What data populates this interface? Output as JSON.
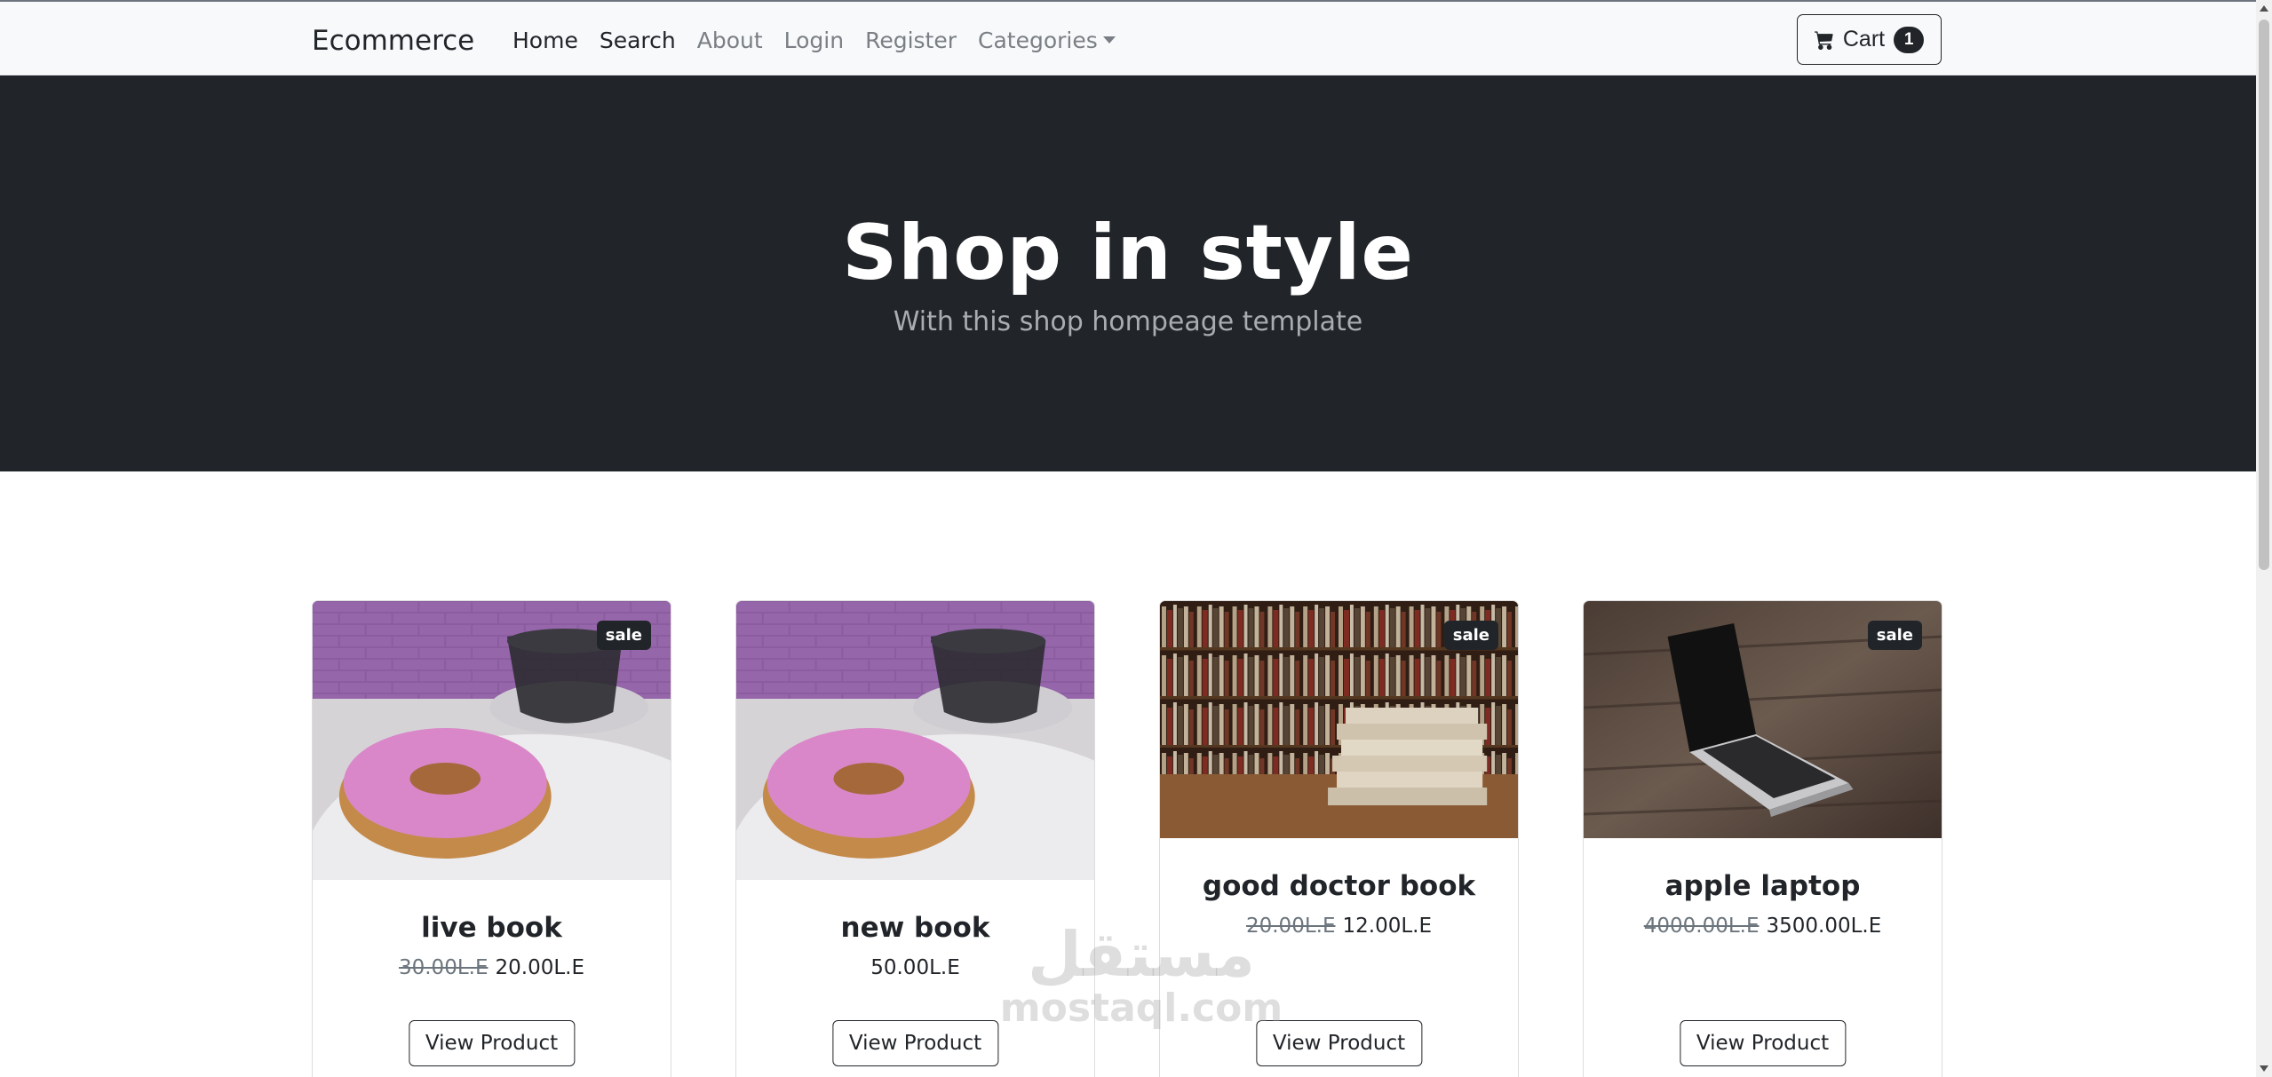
{
  "navbar": {
    "brand": "Ecommerce",
    "links": [
      {
        "label": "Home"
      },
      {
        "label": "Search"
      },
      {
        "label": "About"
      },
      {
        "label": "Login"
      },
      {
        "label": "Register"
      },
      {
        "label": "Categories"
      }
    ],
    "cart": {
      "label": "Cart",
      "count": "1",
      "icon": "cart-icon"
    }
  },
  "hero": {
    "title": "Shop in style",
    "subtitle": "With this shop hompeage template"
  },
  "products": [
    {
      "name": "live book",
      "old_price": "30.00L.E",
      "price": "20.00L.E",
      "badge": "sale",
      "image": "donut-coffee",
      "button": "View Product"
    },
    {
      "name": "new book",
      "old_price": "",
      "price": "50.00L.E",
      "badge": "",
      "image": "donut-coffee",
      "button": "View Product"
    },
    {
      "name": "good doctor book",
      "old_price": "20.00L.E",
      "price": "12.00L.E",
      "badge": "sale",
      "image": "bookshelf",
      "button": "View Product"
    },
    {
      "name": "apple laptop",
      "old_price": "4000.00L.E",
      "price": "3500.00L.E",
      "badge": "sale",
      "image": "laptop",
      "button": "View Product"
    }
  ],
  "watermark": {
    "arabic": "مستقل",
    "latin": "mostaql.com"
  },
  "colors": {
    "dark": "#212529",
    "light": "#f8f9fa",
    "muted": "#6c757d"
  }
}
